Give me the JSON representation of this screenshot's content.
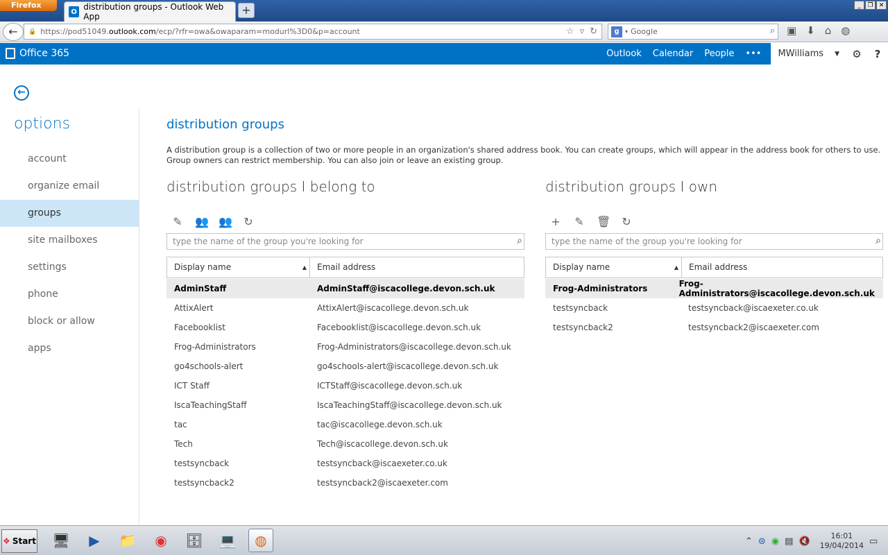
{
  "browser": {
    "app_button": "Firefox",
    "tab_title": "distribution groups - Outlook Web App",
    "tab_favicon": "O",
    "new_tab": "+",
    "url_prefix": "https://pod51049.",
    "url_host": "outlook.com",
    "url_rest": "/ecp/?rfr=owa&owaparam=modurl%3D0&p=account",
    "search_placeholder": "Google",
    "search_engine_logo": "g"
  },
  "o365": {
    "brand": "Office 365",
    "nav": [
      "Outlook",
      "Calendar",
      "People"
    ],
    "more": "•••",
    "user": "MWilliams",
    "user_caret": "▼",
    "settings_icon": "⚙",
    "help_icon": "?"
  },
  "sidebar": {
    "back_icon": "←",
    "title": "options",
    "items": [
      {
        "label": "account"
      },
      {
        "label": "organize email"
      },
      {
        "label": "groups"
      },
      {
        "label": "site mailboxes"
      },
      {
        "label": "settings"
      },
      {
        "label": "phone"
      },
      {
        "label": "block or allow"
      },
      {
        "label": "apps"
      }
    ],
    "selected_index": 2
  },
  "main": {
    "title": "distribution groups",
    "description": "A distribution group is a collection of two or more people in an organization's shared address book. You can create groups, which will appear in the address book for others to use. Group owners can restrict membership. You can also join or leave an existing group.",
    "belong": {
      "title": "distribution groups I belong to",
      "search_placeholder": "type the name of the group you're looking for",
      "col_display": "Display name",
      "col_email": "Email address",
      "rows": [
        {
          "name": "AdminStaff",
          "email": "AdminStaff@iscacollege.devon.sch.uk"
        },
        {
          "name": "AttixAlert",
          "email": "AttixAlert@iscacollege.devon.sch.uk"
        },
        {
          "name": "Facebooklist",
          "email": "Facebooklist@iscacollege.devon.sch.uk"
        },
        {
          "name": "Frog-Administrators",
          "email": "Frog-Administrators@iscacollege.devon.sch.uk"
        },
        {
          "name": "go4schools-alert",
          "email": "go4schools-alert@iscacollege.devon.sch.uk"
        },
        {
          "name": "ICT Staff",
          "email": "ICTStaff@iscacollege.devon.sch.uk"
        },
        {
          "name": "IscaTeachingStaff",
          "email": "IscaTeachingStaff@iscacollege.devon.sch.uk"
        },
        {
          "name": "tac",
          "email": "tac@iscacollege.devon.sch.uk"
        },
        {
          "name": "Tech",
          "email": "Tech@iscacollege.devon.sch.uk"
        },
        {
          "name": "testsyncback",
          "email": "testsyncback@iscaexeter.co.uk"
        },
        {
          "name": "testsyncback2",
          "email": "testsyncback2@iscaexeter.com"
        }
      ]
    },
    "own": {
      "title": "distribution groups I own",
      "search_placeholder": "type the name of the group you're looking for",
      "col_display": "Display name",
      "col_email": "Email address",
      "rows": [
        {
          "name": "Frog-Administrators",
          "email": "Frog-Administrators@iscacollege.devon.sch.uk"
        },
        {
          "name": "testsyncback",
          "email": "testsyncback@iscaexeter.co.uk"
        },
        {
          "name": "testsyncback2",
          "email": "testsyncback2@iscaexeter.com"
        }
      ]
    }
  },
  "taskbar": {
    "start": "Start",
    "time": "16:01",
    "date": "19/04/2014"
  },
  "colors": {
    "accent": "#0072c6",
    "selected_nav": "#cde6f7",
    "selected_row": "#eaeaea"
  }
}
